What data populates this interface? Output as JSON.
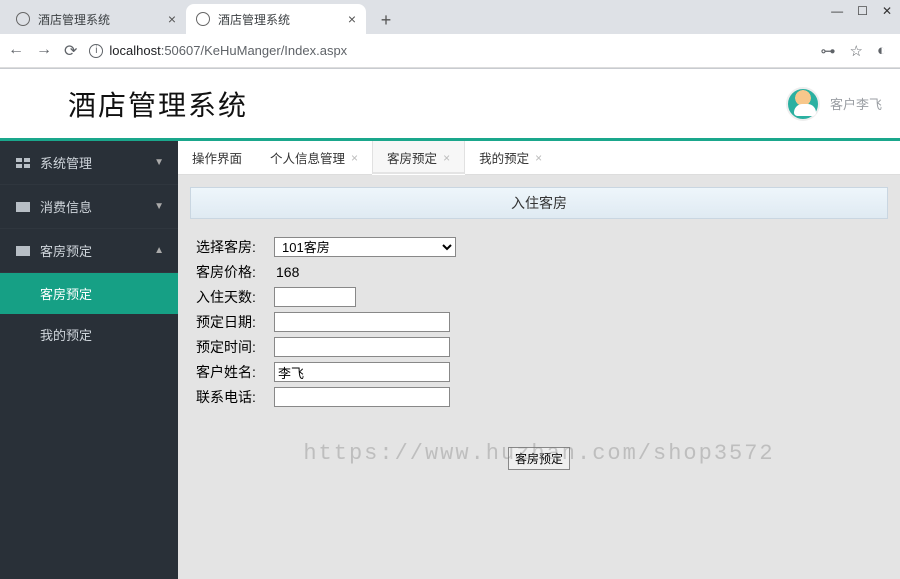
{
  "browser": {
    "tabs": [
      {
        "title": "酒店管理系统"
      },
      {
        "title": "酒店管理系统"
      }
    ],
    "url_host": "localhost",
    "url_port": ":50607",
    "url_path": "/KeHuManger/Index.aspx"
  },
  "header": {
    "title": "酒店管理系统",
    "user_label": "客户李飞"
  },
  "sidebar": {
    "items": [
      {
        "label": "系统管理"
      },
      {
        "label": "消费信息"
      },
      {
        "label": "客房预定"
      }
    ],
    "sub_items": [
      {
        "label": "客房预定"
      },
      {
        "label": "我的预定"
      }
    ]
  },
  "content_tabs": [
    {
      "label": "操作界面",
      "closable": false
    },
    {
      "label": "个人信息管理",
      "closable": true
    },
    {
      "label": "客房预定",
      "closable": true
    },
    {
      "label": "我的预定",
      "closable": true
    }
  ],
  "panel": {
    "title": "入住客房",
    "fields": {
      "room_label": "选择客房:",
      "room_value": "101客房",
      "price_label": "客房价格:",
      "price_value": "168",
      "days_label": "入住天数:",
      "days_value": "",
      "date_label": "预定日期:",
      "date_value": "",
      "time_label": "预定时间:",
      "time_value": "",
      "name_label": "客户姓名:",
      "name_value": "李飞",
      "phone_label": "联系电话:",
      "phone_value": ""
    },
    "submit_label": "客房预定"
  },
  "watermark": "https://www.huzhan.com/shop3572"
}
